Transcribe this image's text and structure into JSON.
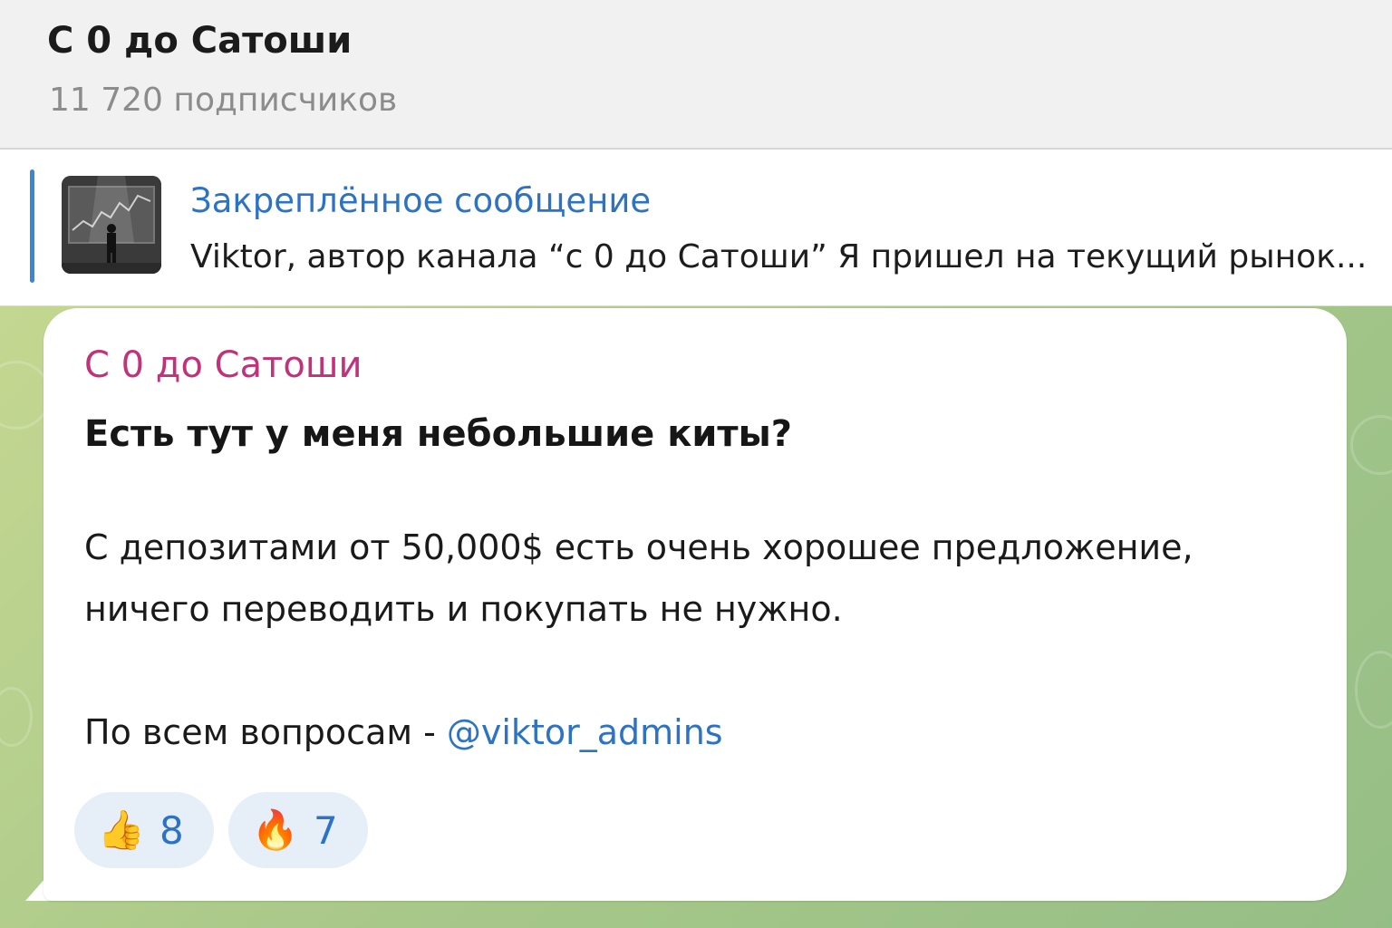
{
  "header": {
    "channel_title": "С 0 до Сатоши",
    "subscribers": "11 720 подписчиков"
  },
  "pinned": {
    "label": "Закреплённое сообщение",
    "preview": "Viktor, автор канала “с 0 до Сатоши”  Я пришел на текущий рынок..."
  },
  "message": {
    "sender": "С 0 до Сатоши",
    "headline": "Есть тут у меня небольшие киты?",
    "line1": "С депозитами от 50,000$ есть очень хорошее предложение,",
    "line2": "ничего переводить и покупать не нужно.",
    "line3_prefix": "По всем вопросам - ",
    "mention": "@viktor_admins",
    "reactions": [
      {
        "emoji": "👍",
        "count": "8"
      },
      {
        "emoji": "🔥",
        "count": "7"
      }
    ]
  },
  "colors": {
    "accent": "#2d73c4",
    "sender": "#c1327a",
    "chat_bg": "#aac98a"
  }
}
